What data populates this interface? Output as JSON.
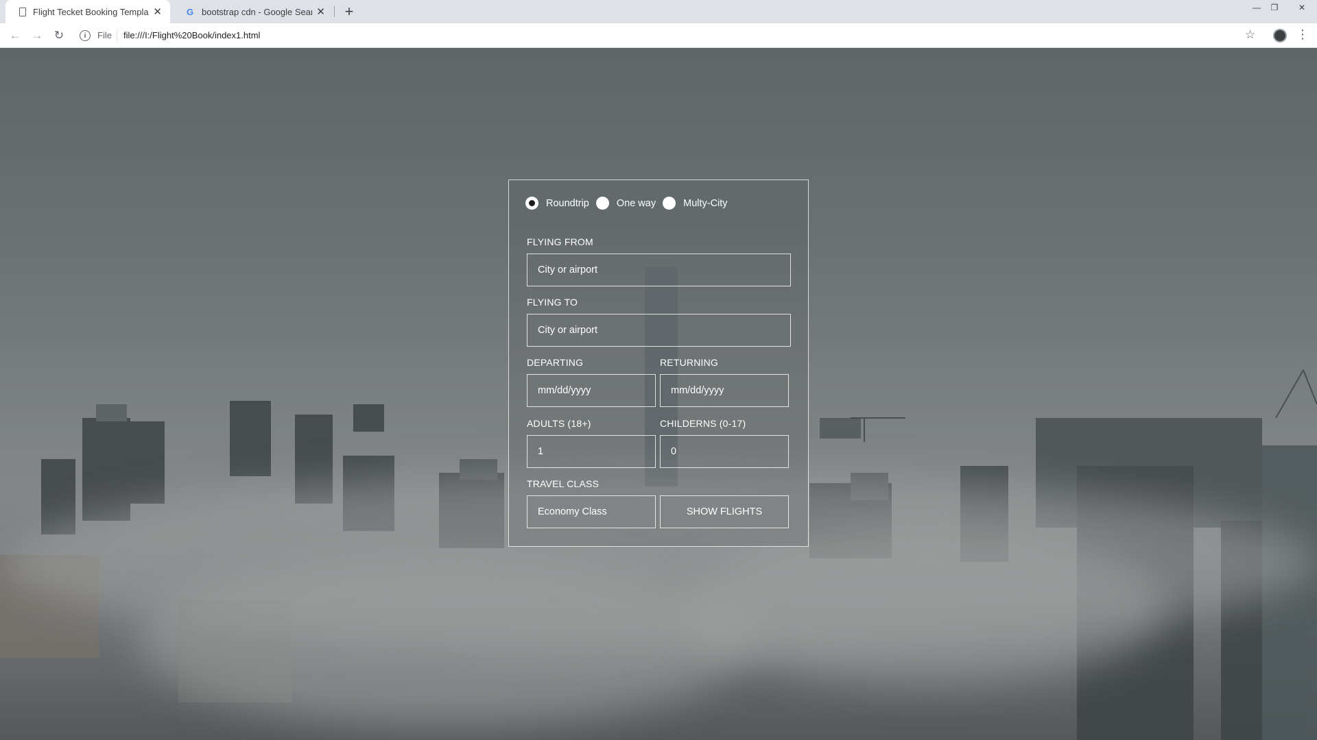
{
  "browser": {
    "tabs": [
      {
        "title": "Flight Tecket Booking Template",
        "close": "✕",
        "favicon": "document-icon"
      },
      {
        "title": "bootstrap cdn - Google Search",
        "close": "✕",
        "favicon": "google-icon"
      }
    ],
    "new_tab": "+",
    "window": {
      "minimize": "—",
      "maximize": "❐",
      "close": "✕"
    },
    "address_bar": {
      "scheme_label": "File",
      "url": "file:///I:/Flight%20Book/index1.html"
    }
  },
  "form": {
    "trip_type": {
      "options": [
        "Roundtrip",
        "One way",
        "Multy-City"
      ],
      "selected": "Roundtrip"
    },
    "flying_from": {
      "label": "FLYING FROM",
      "placeholder": "City or airport"
    },
    "flying_to": {
      "label": "FLYING TO",
      "placeholder": "City or airport"
    },
    "departing": {
      "label": "DEPARTING",
      "placeholder": "mm/dd/yyyy"
    },
    "returning": {
      "label": "RETURNING",
      "placeholder": "mm/dd/yyyy"
    },
    "adults": {
      "label": "ADULTS (18+)",
      "value": "1"
    },
    "children": {
      "label": "CHILDERNS (0-17)",
      "value": "0"
    },
    "travel_class": {
      "label": "TRAVEL CLASS",
      "value": "Economy Class"
    },
    "submit_label": "SHOW FLIGHTS"
  },
  "colors": {
    "form_text": "#ffffff",
    "form_border": "#ffffff",
    "background": "#6b7172"
  }
}
